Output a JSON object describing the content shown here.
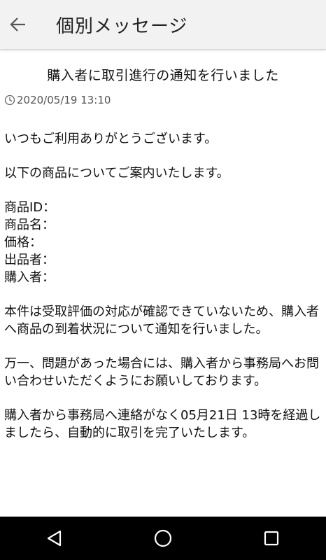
{
  "header": {
    "back_icon": "arrow-left-icon",
    "title": "個別メッセージ"
  },
  "message": {
    "title": "購入者に取引進行の通知を行いました",
    "clock_icon": "clock-icon",
    "timestamp": "2020/05/19 13:10",
    "greeting": "いつもご利用ありがとうございます。",
    "intro": "以下の商品についてご案内いたします。",
    "fields": [
      {
        "label": "商品ID：",
        "value": ""
      },
      {
        "label": "商品名：",
        "value": ""
      },
      {
        "label": "価格：",
        "value": ""
      },
      {
        "label": "出品者：",
        "value": ""
      },
      {
        "label": "購入者：",
        "value": ""
      }
    ],
    "paragraph1": "本件は受取評価の対応が確認できていないため、購入者へ商品の到着状況について通知を行いました。",
    "paragraph2": "万一、問題があった場合には、購入者から事務局へお問い合わせいただくようにお願いしております。",
    "paragraph3": "購入者から事務局へ連絡がなく05月21日 13時を経過しましたら、自動的に取引を完了いたします。"
  },
  "navbar": {
    "back_icon": "nav-back-triangle-icon",
    "home_icon": "nav-home-circle-icon",
    "recents_icon": "nav-recents-square-icon"
  },
  "colors": {
    "appbar_bg": "#f2f2f2",
    "navbar_bg": "#000000",
    "text": "#111111",
    "timestamp": "#555555"
  }
}
